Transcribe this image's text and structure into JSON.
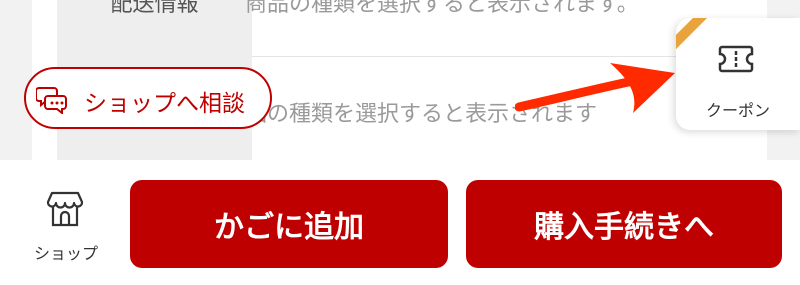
{
  "product_info": {
    "rows": [
      {
        "label": "配送情報",
        "value": "商品の種類を選択すると表示されます。"
      },
      {
        "label": "",
        "value": "品の種類を選択すると表示されます"
      }
    ]
  },
  "consult": {
    "label": "ショップへ相談",
    "icon": "chat-bubbles-icon"
  },
  "coupon": {
    "label": "クーポン",
    "icon": "ticket-icon"
  },
  "bottom_bar": {
    "shop": {
      "label": "ショップ",
      "icon": "storefront-icon"
    },
    "add_to_cart": "かごに追加",
    "checkout": "購入手続きへ"
  },
  "colors": {
    "accent": "#bf0000",
    "ribbon": "#e8a33c",
    "annotation_arrow": "#ff2a00"
  }
}
